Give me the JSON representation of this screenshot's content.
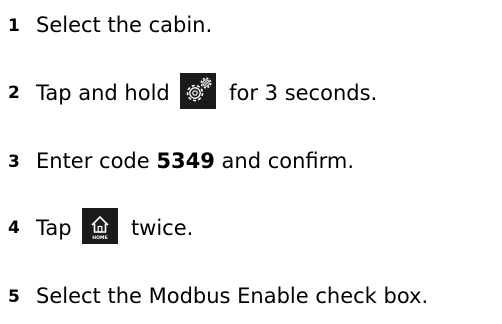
{
  "steps": [
    {
      "number": "1",
      "text": "Select the cabin."
    },
    {
      "number": "2",
      "text_before": "Tap and hold",
      "icon": "settings-gears-icon",
      "text_after": "for 3 seconds."
    },
    {
      "number": "3",
      "text_before": "Enter code",
      "code": "5349",
      "text_after": "and confirm."
    },
    {
      "number": "4",
      "text_before": "Tap",
      "icon": "home-icon",
      "icon_label": "HOME",
      "text_after": "twice."
    },
    {
      "number": "5",
      "text": "Select the Modbus Enable check box."
    }
  ],
  "colors": {
    "text": "#000000",
    "icon_background": "#1b1b1b",
    "icon_foreground": "#ffffff"
  }
}
